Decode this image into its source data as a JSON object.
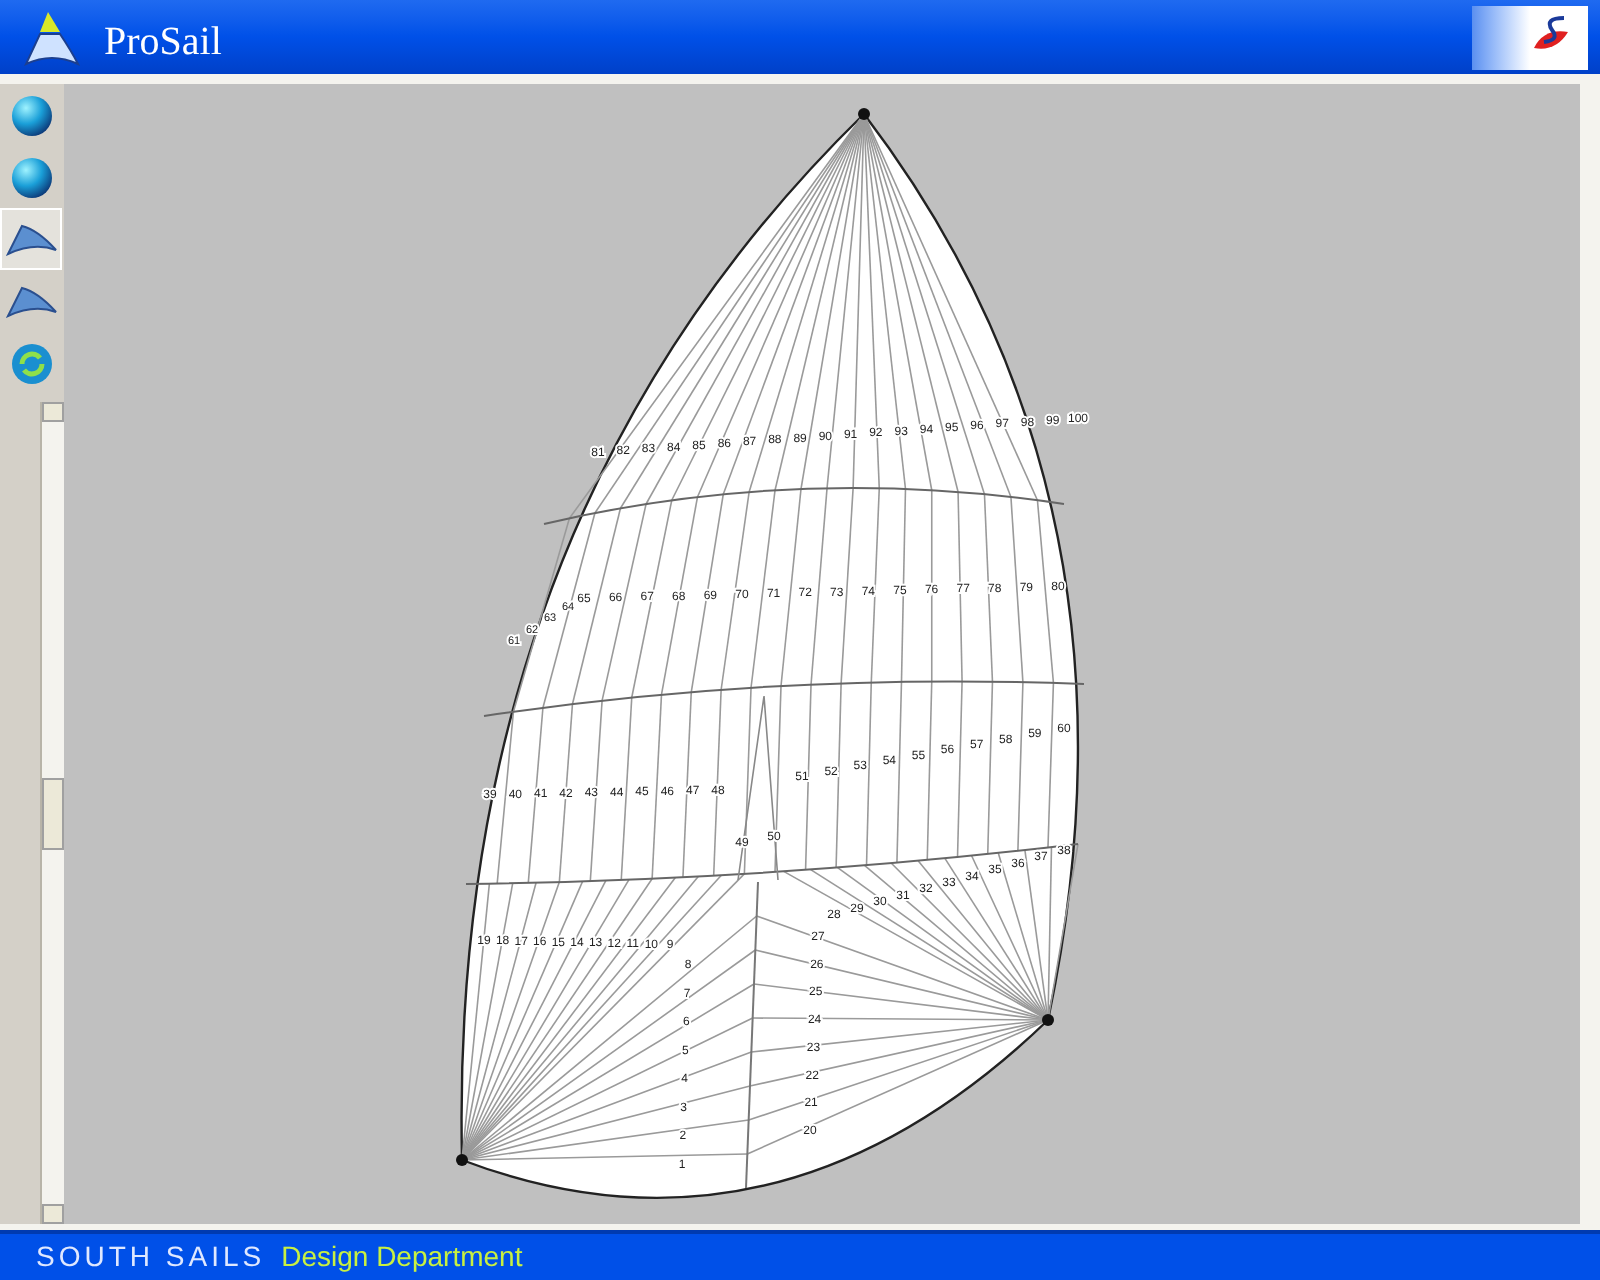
{
  "window": {
    "title": "ProSail"
  },
  "toolbar": [
    {
      "kind": "globe",
      "selected": false
    },
    {
      "kind": "globe",
      "selected": false
    },
    {
      "kind": "sail",
      "selected": true
    },
    {
      "kind": "sail",
      "selected": false
    },
    {
      "kind": "refresh",
      "selected": false
    }
  ],
  "panel_numbers": [
    "81",
    "82",
    "83",
    "84",
    "85",
    "86",
    "87",
    "88",
    "89",
    "90",
    "91",
    "92",
    "93",
    "94",
    "95",
    "96",
    "97",
    "98",
    "99",
    "100",
    "61",
    "62",
    "63",
    "64",
    "65",
    "66",
    "67",
    "68",
    "69",
    "70",
    "71",
    "72",
    "73",
    "74",
    "75",
    "76",
    "77",
    "78",
    "79",
    "80",
    "39",
    "40",
    "41",
    "42",
    "43",
    "44",
    "45",
    "46",
    "47",
    "48",
    "51",
    "52",
    "53",
    "54",
    "55",
    "56",
    "57",
    "58",
    "59",
    "60",
    "49",
    "50",
    "28",
    "29",
    "30",
    "31",
    "32",
    "33",
    "34",
    "35",
    "36",
    "37",
    "38",
    "19",
    "18",
    "17",
    "16",
    "15",
    "14",
    "13",
    "12",
    "11",
    "10",
    "9",
    "8",
    "7",
    "6",
    "5",
    "4",
    "3",
    "2",
    "1",
    "27",
    "26",
    "25",
    "24",
    "23",
    "22",
    "21",
    "20"
  ],
  "footer": {
    "company": "SOUTH SAILS",
    "department": "Design Department"
  }
}
